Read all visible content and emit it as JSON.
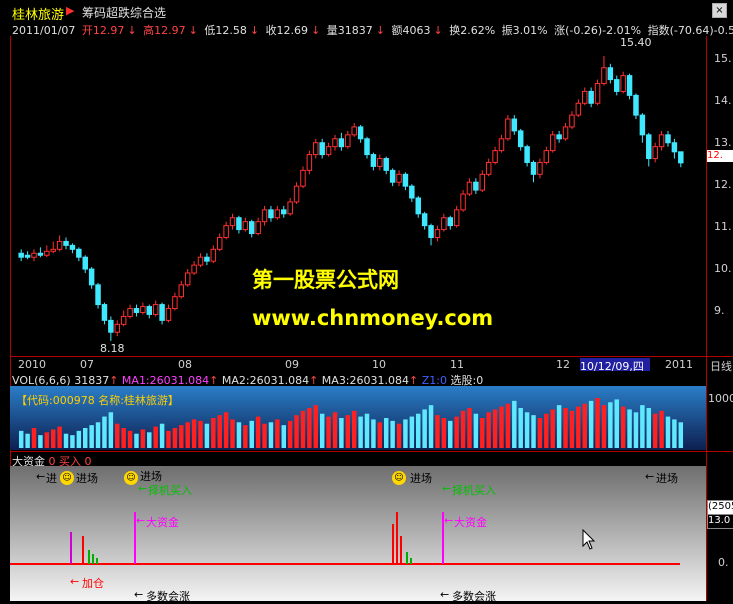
{
  "title_bar": {
    "stock_name": "桂林旅游",
    "indicator_name": "筹码超跌综合选",
    "close_glyph": "×"
  },
  "quote": {
    "date": "2011/01/07",
    "open": "开12.97",
    "high": "高12.97",
    "low": "低12.58",
    "close": "收12.69",
    "volume": "量31837",
    "amount": "额4063",
    "turnover": "换2.62%",
    "amplitude": "振3.01%",
    "change": "涨(-0.26)-2.01%",
    "index": "指数(-70.64)-0.56%"
  },
  "price_axis": [
    "15.",
    "14.",
    "13.",
    "12.",
    "11.",
    "10.",
    "9."
  ],
  "price_tag": "12.",
  "annotations": {
    "high_label": "15.40",
    "low_label": "8.18"
  },
  "watermark": {
    "line1": "第一股票公式网",
    "line2": "www.chnmoney.com"
  },
  "date_axis": [
    "2010",
    "07",
    "08",
    "09",
    "10",
    "11",
    "12",
    "10/12/09,四",
    "2011",
    "日线"
  ],
  "volume_panel": {
    "header_vol": "VOL(6,6,6)",
    "header_value": "31837",
    "ma1": "MA1:26031.084",
    "ma2": "MA2:26031.084",
    "ma3": "MA3:26031.084",
    "z1": "Z1:0",
    "select": "选股:0",
    "code_text": "【代码:000978 名称:桂林旅游】",
    "axis_label": "1000"
  },
  "bottom_panel": {
    "header_name": "大资金",
    "header_value": "0",
    "header_buy": "买入",
    "header_buy_value": "0",
    "jinchang": "进场",
    "jin_short": "进",
    "zeji": "择机买入",
    "dazijin": "大资金",
    "jiacang": "加仓",
    "duoshu": "多数会涨",
    "right_box1": "(2505",
    "right_box2": "13.0",
    "zero_label": "0."
  },
  "chart_data": {
    "type": "candlestick",
    "title": "桂林旅游",
    "ylim": [
      8.0,
      15.6
    ],
    "candles": [
      [
        10.4,
        10.3,
        10.5,
        10.2
      ],
      [
        10.35,
        10.3,
        10.45,
        10.25
      ],
      [
        10.3,
        10.4,
        10.5,
        10.2
      ],
      [
        10.4,
        10.35,
        10.55,
        10.3
      ],
      [
        10.35,
        10.45,
        10.6,
        10.3
      ],
      [
        10.45,
        10.5,
        10.7,
        10.4
      ],
      [
        10.5,
        10.7,
        10.85,
        10.45
      ],
      [
        10.7,
        10.6,
        10.8,
        10.5
      ],
      [
        10.6,
        10.5,
        10.65,
        10.4
      ],
      [
        10.5,
        10.3,
        10.55,
        10.2
      ],
      [
        10.3,
        10.0,
        10.35,
        9.9
      ],
      [
        10.0,
        9.6,
        10.05,
        9.5
      ],
      [
        9.6,
        9.1,
        9.65,
        9.0
      ],
      [
        9.1,
        8.7,
        9.15,
        8.6
      ],
      [
        8.7,
        8.4,
        8.8,
        8.18
      ],
      [
        8.4,
        8.6,
        8.7,
        8.3
      ],
      [
        8.6,
        8.8,
        8.95,
        8.55
      ],
      [
        8.8,
        9.0,
        9.1,
        8.75
      ],
      [
        9.0,
        8.9,
        9.1,
        8.8
      ],
      [
        8.9,
        9.05,
        9.15,
        8.85
      ],
      [
        9.05,
        8.85,
        9.1,
        8.75
      ],
      [
        8.85,
        9.1,
        9.2,
        8.8
      ],
      [
        9.1,
        8.7,
        9.15,
        8.6
      ],
      [
        8.7,
        9.0,
        9.1,
        8.65
      ],
      [
        9.0,
        9.3,
        9.4,
        8.95
      ],
      [
        9.3,
        9.6,
        9.7,
        9.25
      ],
      [
        9.6,
        9.9,
        10.0,
        9.55
      ],
      [
        9.9,
        10.1,
        10.2,
        9.85
      ],
      [
        10.1,
        10.3,
        10.4,
        10.05
      ],
      [
        10.3,
        10.2,
        10.4,
        10.1
      ],
      [
        10.2,
        10.5,
        10.6,
        10.15
      ],
      [
        10.5,
        10.8,
        10.9,
        10.45
      ],
      [
        10.8,
        11.1,
        11.2,
        10.75
      ],
      [
        11.1,
        11.3,
        11.4,
        11.0
      ],
      [
        11.3,
        11.0,
        11.35,
        10.9
      ],
      [
        11.0,
        11.2,
        11.3,
        10.95
      ],
      [
        11.2,
        10.9,
        11.25,
        10.8
      ],
      [
        10.9,
        11.2,
        11.3,
        10.85
      ],
      [
        11.2,
        11.5,
        11.6,
        11.1
      ],
      [
        11.5,
        11.3,
        11.6,
        11.2
      ],
      [
        11.3,
        11.5,
        11.6,
        11.25
      ],
      [
        11.5,
        11.4,
        11.6,
        11.3
      ],
      [
        11.4,
        11.7,
        11.8,
        11.35
      ],
      [
        11.7,
        12.1,
        12.2,
        11.65
      ],
      [
        12.1,
        12.5,
        12.6,
        12.05
      ],
      [
        12.5,
        12.9,
        13.0,
        12.4
      ],
      [
        12.9,
        13.2,
        13.3,
        12.8
      ],
      [
        13.2,
        12.9,
        13.3,
        12.8
      ],
      [
        12.9,
        13.1,
        13.2,
        12.85
      ],
      [
        13.1,
        13.3,
        13.4,
        13.0
      ],
      [
        13.3,
        13.1,
        13.45,
        13.0
      ],
      [
        13.1,
        13.4,
        13.5,
        13.05
      ],
      [
        13.4,
        13.6,
        13.7,
        13.35
      ],
      [
        13.6,
        13.3,
        13.65,
        13.2
      ],
      [
        13.3,
        12.9,
        13.35,
        12.8
      ],
      [
        12.9,
        12.6,
        12.95,
        12.5
      ],
      [
        12.6,
        12.8,
        12.9,
        12.5
      ],
      [
        12.8,
        12.5,
        12.85,
        12.4
      ],
      [
        12.5,
        12.2,
        12.55,
        12.1
      ],
      [
        12.2,
        12.4,
        12.5,
        12.1
      ],
      [
        12.4,
        12.1,
        12.45,
        12.0
      ],
      [
        12.1,
        11.8,
        12.15,
        11.7
      ],
      [
        11.8,
        11.4,
        11.85,
        11.3
      ],
      [
        11.4,
        11.1,
        11.45,
        11.0
      ],
      [
        11.1,
        10.8,
        11.15,
        10.6
      ],
      [
        10.8,
        11.0,
        11.1,
        10.7
      ],
      [
        11.0,
        11.3,
        11.4,
        10.95
      ],
      [
        11.3,
        11.1,
        11.35,
        11.0
      ],
      [
        11.1,
        11.5,
        11.6,
        11.05
      ],
      [
        11.5,
        11.9,
        12.0,
        11.45
      ],
      [
        11.9,
        12.2,
        12.3,
        11.85
      ],
      [
        12.2,
        12.0,
        12.3,
        11.9
      ],
      [
        12.0,
        12.4,
        12.5,
        11.95
      ],
      [
        12.4,
        12.7,
        12.8,
        12.35
      ],
      [
        12.7,
        13.0,
        13.1,
        12.65
      ],
      [
        13.0,
        13.3,
        13.4,
        12.95
      ],
      [
        13.3,
        13.8,
        13.9,
        13.25
      ],
      [
        13.8,
        13.5,
        13.9,
        13.4
      ],
      [
        13.5,
        13.1,
        13.55,
        13.0
      ],
      [
        13.1,
        12.7,
        13.15,
        12.6
      ],
      [
        12.7,
        12.4,
        12.75,
        12.2
      ],
      [
        12.4,
        12.7,
        12.8,
        12.3
      ],
      [
        12.7,
        13.0,
        13.1,
        12.65
      ],
      [
        13.0,
        13.4,
        13.5,
        12.95
      ],
      [
        13.4,
        13.3,
        13.5,
        13.2
      ],
      [
        13.3,
        13.6,
        13.7,
        13.25
      ],
      [
        13.6,
        13.9,
        14.0,
        13.55
      ],
      [
        13.9,
        14.2,
        14.3,
        13.85
      ],
      [
        14.2,
        14.5,
        14.6,
        14.15
      ],
      [
        14.5,
        14.2,
        14.6,
        14.1
      ],
      [
        14.2,
        14.7,
        14.8,
        14.15
      ],
      [
        14.7,
        15.1,
        15.4,
        14.65
      ],
      [
        15.1,
        14.8,
        15.2,
        14.7
      ],
      [
        14.8,
        14.5,
        14.9,
        14.4
      ],
      [
        14.5,
        14.9,
        15.0,
        14.45
      ],
      [
        14.9,
        14.4,
        14.95,
        14.3
      ],
      [
        14.4,
        13.9,
        14.45,
        13.8
      ],
      [
        13.9,
        13.4,
        13.95,
        13.2
      ],
      [
        13.4,
        12.8,
        13.45,
        12.6
      ],
      [
        12.8,
        13.1,
        13.2,
        12.7
      ],
      [
        13.1,
        13.4,
        13.5,
        13.0
      ],
      [
        13.4,
        13.2,
        13.5,
        13.1
      ],
      [
        13.2,
        12.97,
        13.3,
        12.8
      ],
      [
        12.97,
        12.69,
        12.97,
        12.58
      ]
    ],
    "volume": [
      12,
      10,
      14,
      9,
      11,
      13,
      15,
      10,
      9,
      12,
      14,
      16,
      18,
      22,
      25,
      17,
      14,
      12,
      10,
      13,
      11,
      15,
      17,
      12,
      14,
      16,
      18,
      20,
      19,
      17,
      21,
      23,
      25,
      20,
      18,
      16,
      19,
      22,
      17,
      18,
      20,
      16,
      19,
      23,
      26,
      28,
      30,
      24,
      22,
      25,
      21,
      23,
      26,
      22,
      24,
      20,
      18,
      21,
      19,
      17,
      20,
      22,
      24,
      27,
      30,
      23,
      21,
      19,
      22,
      26,
      28,
      24,
      21,
      25,
      27,
      29,
      31,
      33,
      28,
      25,
      23,
      21,
      24,
      27,
      30,
      28,
      26,
      29,
      31,
      33,
      35,
      30,
      32,
      34,
      29,
      27,
      25,
      30,
      28,
      24,
      26,
      22,
      20,
      18
    ]
  }
}
